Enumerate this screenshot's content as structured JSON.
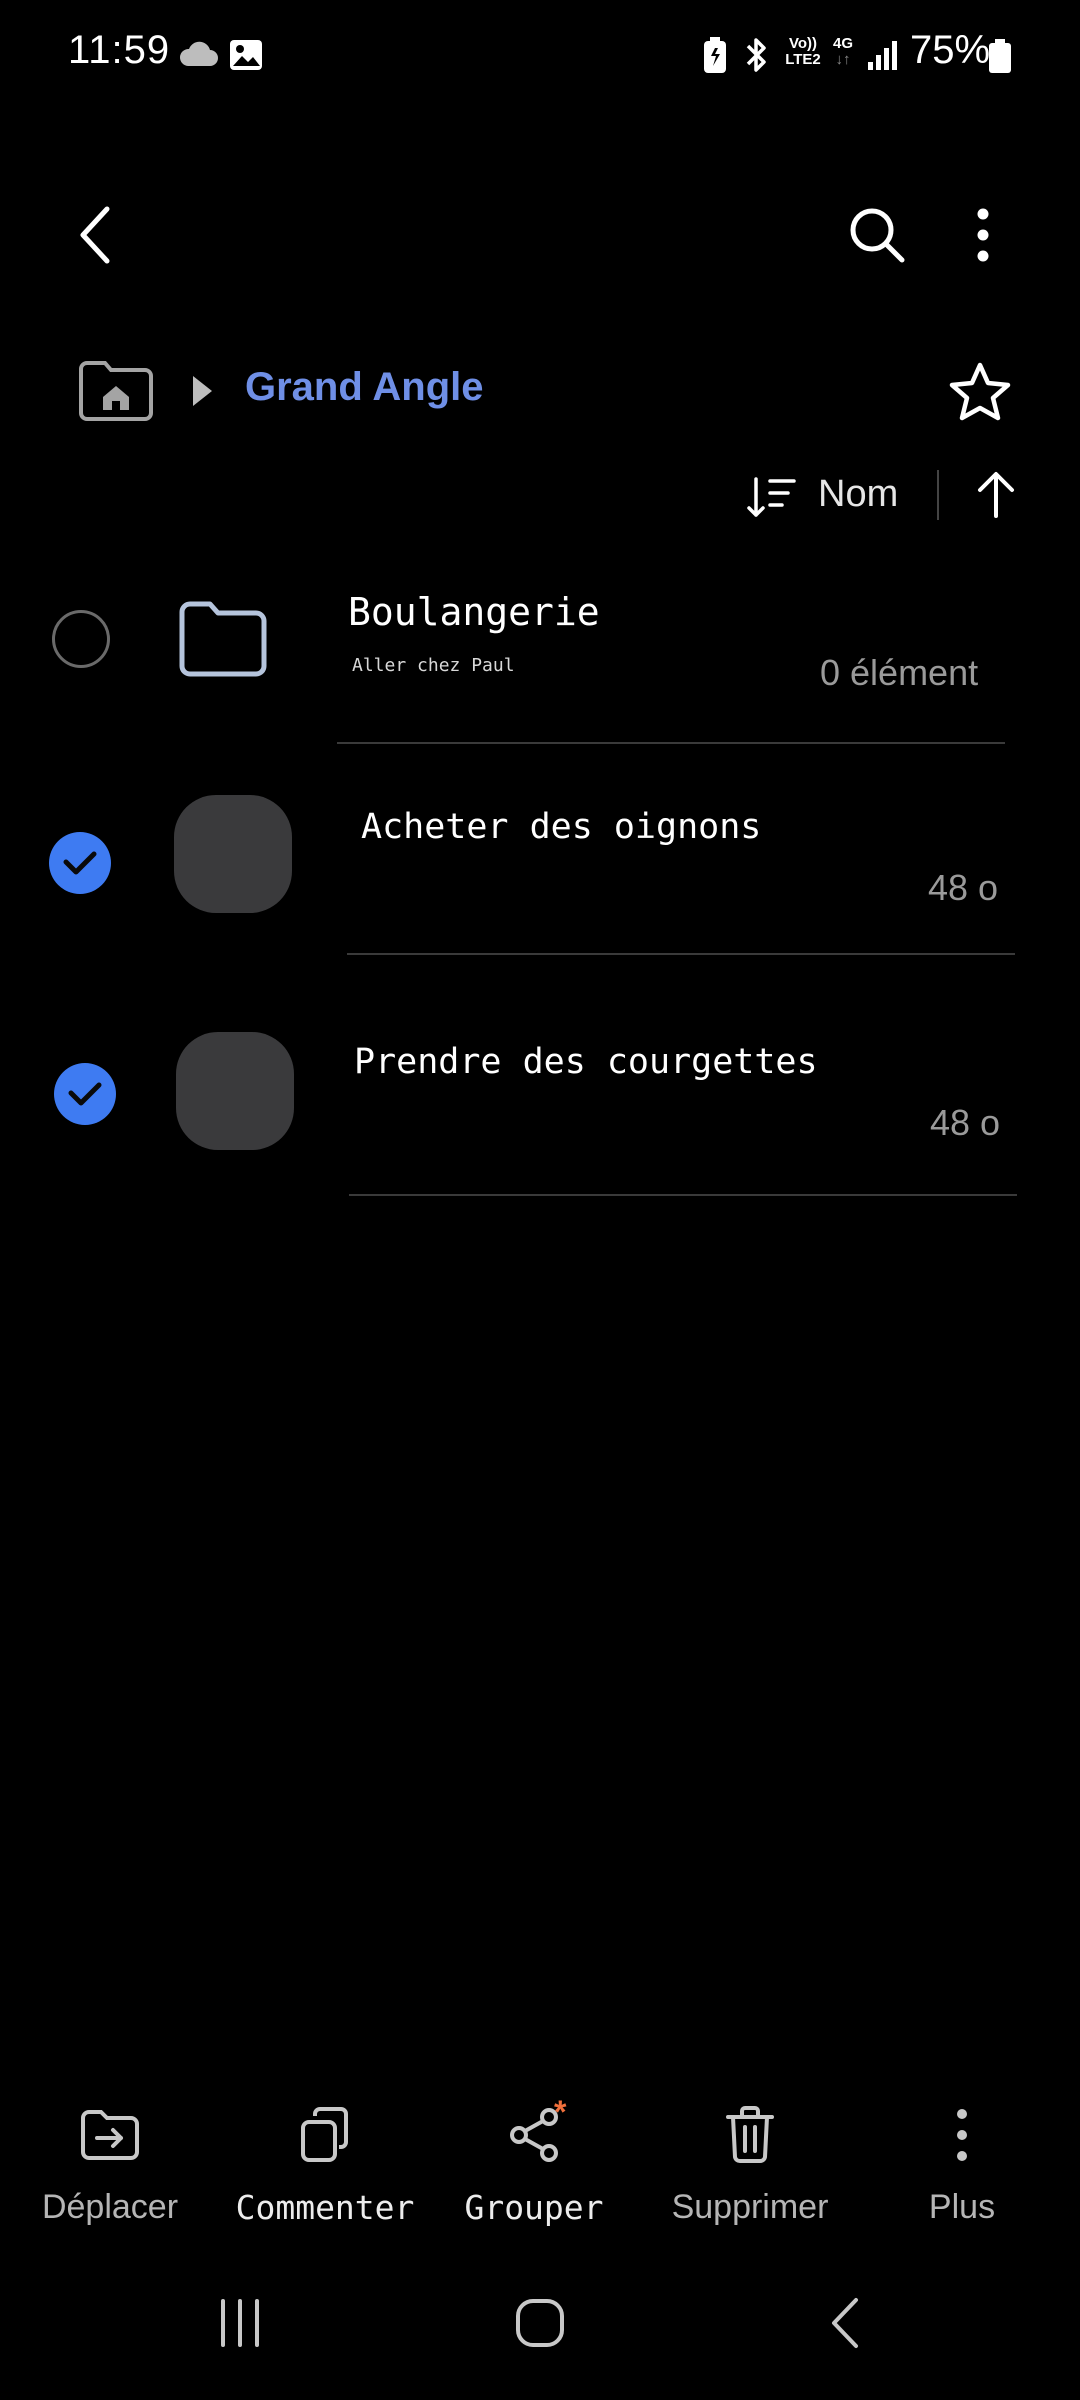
{
  "status_bar": {
    "time": "11:59",
    "network_top": "Vo))",
    "network_bottom": "LTE2",
    "gen_label": "4G",
    "battery_percent": "75%"
  },
  "toolbar": {
    "back_icon": "back-arrow-icon",
    "search_icon": "search-icon",
    "more_icon": "more-vert-icon"
  },
  "breadcrumb": {
    "home_icon": "home-folder-icon",
    "current": "Grand Angle",
    "favorite_icon": "star-outline-icon"
  },
  "sort": {
    "label": "Nom",
    "direction": "ascending"
  },
  "items": [
    {
      "type": "folder",
      "title": "Boulangerie",
      "subtitle": "Aller chez Paul",
      "meta": "0 élément",
      "selected": false
    },
    {
      "type": "file",
      "title": "Acheter des oignons",
      "meta": "48 o",
      "selected": true
    },
    {
      "type": "file",
      "title": "Prendre des courgettes",
      "meta": "48 o",
      "selected": true
    }
  ],
  "actions": [
    {
      "label": "Déplacer",
      "icon": "move-icon"
    },
    {
      "label": "Commenter",
      "icon": "copy-icon"
    },
    {
      "label": "Grouper",
      "icon": "share-icon",
      "badge": "*"
    },
    {
      "label": "Supprimer",
      "icon": "trash-icon"
    },
    {
      "label": "Plus",
      "icon": "more-vert-icon"
    }
  ],
  "colors": {
    "accent": "#3e7bf2",
    "breadcrumb": "#6f8fe6",
    "badge": "#f0703c"
  }
}
